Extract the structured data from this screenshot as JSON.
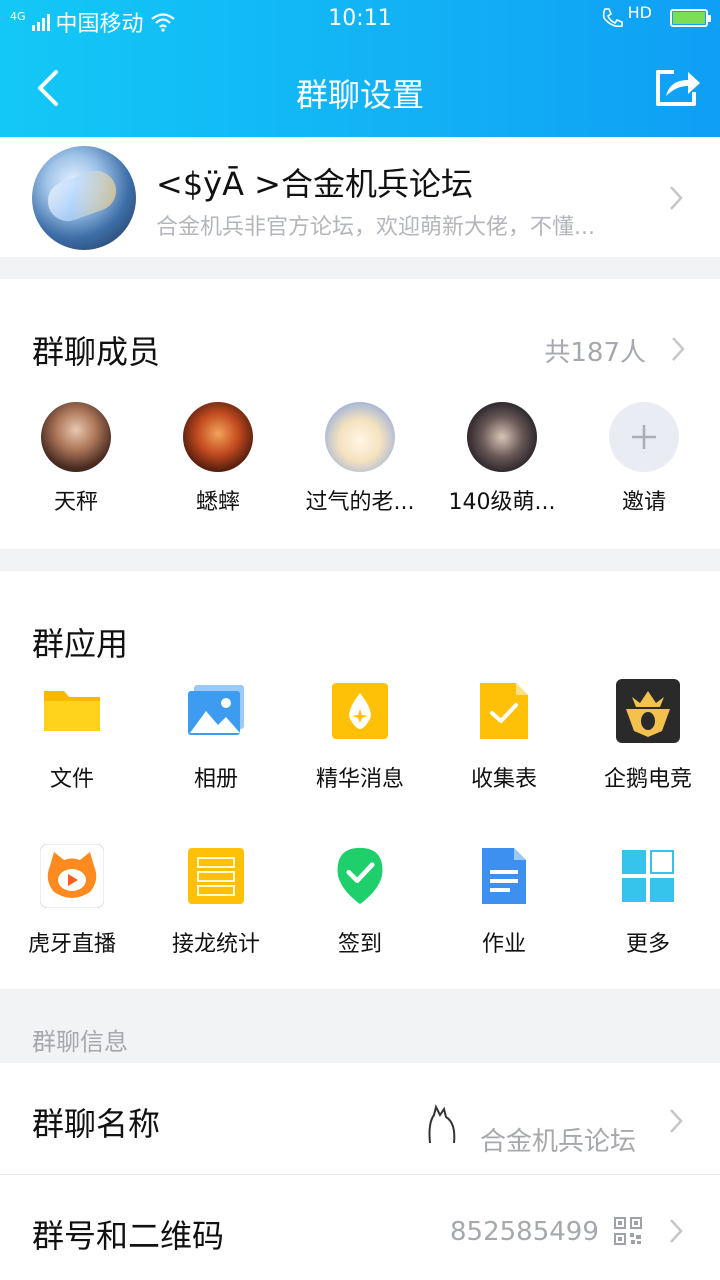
{
  "status_bar": {
    "network": "4G",
    "carrier": "中国移动",
    "time": "10:11",
    "hd": "HD",
    "battery_percent": 100
  },
  "header": {
    "title": "群聊设置"
  },
  "group": {
    "name": "<$ÿĀ >合金机兵论坛",
    "description": "合金机兵非官方论坛，欢迎萌新大佬，不懂..."
  },
  "members": {
    "title": "群聊成员",
    "count_label": "共187人",
    "list": [
      {
        "name": "天秤"
      },
      {
        "name": "蟋蟀"
      },
      {
        "name": "过气的老..."
      },
      {
        "name": "140级萌..."
      }
    ],
    "invite_label": "邀请"
  },
  "apps": {
    "title": "群应用",
    "items": [
      {
        "label": "文件",
        "icon": "folder-icon"
      },
      {
        "label": "相册",
        "icon": "photo-album-icon"
      },
      {
        "label": "精华消息",
        "icon": "essence-message-icon"
      },
      {
        "label": "收集表",
        "icon": "collection-form-icon"
      },
      {
        "label": "企鹅电竞",
        "icon": "penguin-esports-icon"
      },
      {
        "label": "虎牙直播",
        "icon": "huya-live-icon"
      },
      {
        "label": "接龙统计",
        "icon": "relay-statistics-icon"
      },
      {
        "label": "签到",
        "icon": "check-in-icon"
      },
      {
        "label": "作业",
        "icon": "homework-icon"
      },
      {
        "label": "更多",
        "icon": "more-apps-icon"
      }
    ]
  },
  "info": {
    "section_label": "群聊信息",
    "name_row": {
      "label": "群聊名称",
      "value": "合金机兵论坛"
    },
    "number_row": {
      "label": "群号和二维码",
      "value": "852585499"
    }
  },
  "colors": {
    "header_start": "#13c8f6",
    "header_end": "#0f9ff5",
    "muted_text": "#a5a8ad"
  }
}
